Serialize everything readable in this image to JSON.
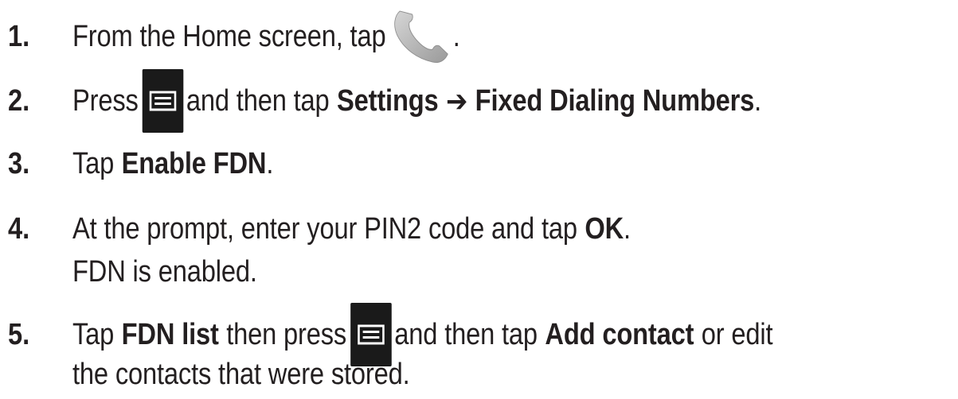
{
  "steps": [
    {
      "number": "1.",
      "parts": {
        "t1": "From the Home screen, tap",
        "t2": "."
      },
      "icon": "phone-icon"
    },
    {
      "number": "2.",
      "parts": {
        "t1": "Press",
        "t2": "and then tap",
        "b1": "Settings",
        "arrow": "➔",
        "b2": "Fixed Dialing Numbers",
        "t3": "."
      },
      "icon": "menu-icon"
    },
    {
      "number": "3.",
      "parts": {
        "t1": "Tap",
        "b1": "Enable FDN",
        "t2": "."
      }
    },
    {
      "number": "4.",
      "parts": {
        "t1": "At the prompt, enter your PIN2 code and tap",
        "b1": "OK",
        "t2": "."
      },
      "result": "FDN is enabled."
    },
    {
      "number": "5.",
      "parts": {
        "t1": "Tap",
        "b1": "FDN list",
        "t2": "then press",
        "t3": "and then tap",
        "b2": "Add contact",
        "t4": "or edit"
      },
      "continuation": "the contacts that were stored.",
      "icon": "menu-icon"
    }
  ],
  "colors": {
    "text": "#231f20",
    "menu_icon_bg": "#1a1a1a",
    "phone_icon": "#b3b3b3"
  }
}
